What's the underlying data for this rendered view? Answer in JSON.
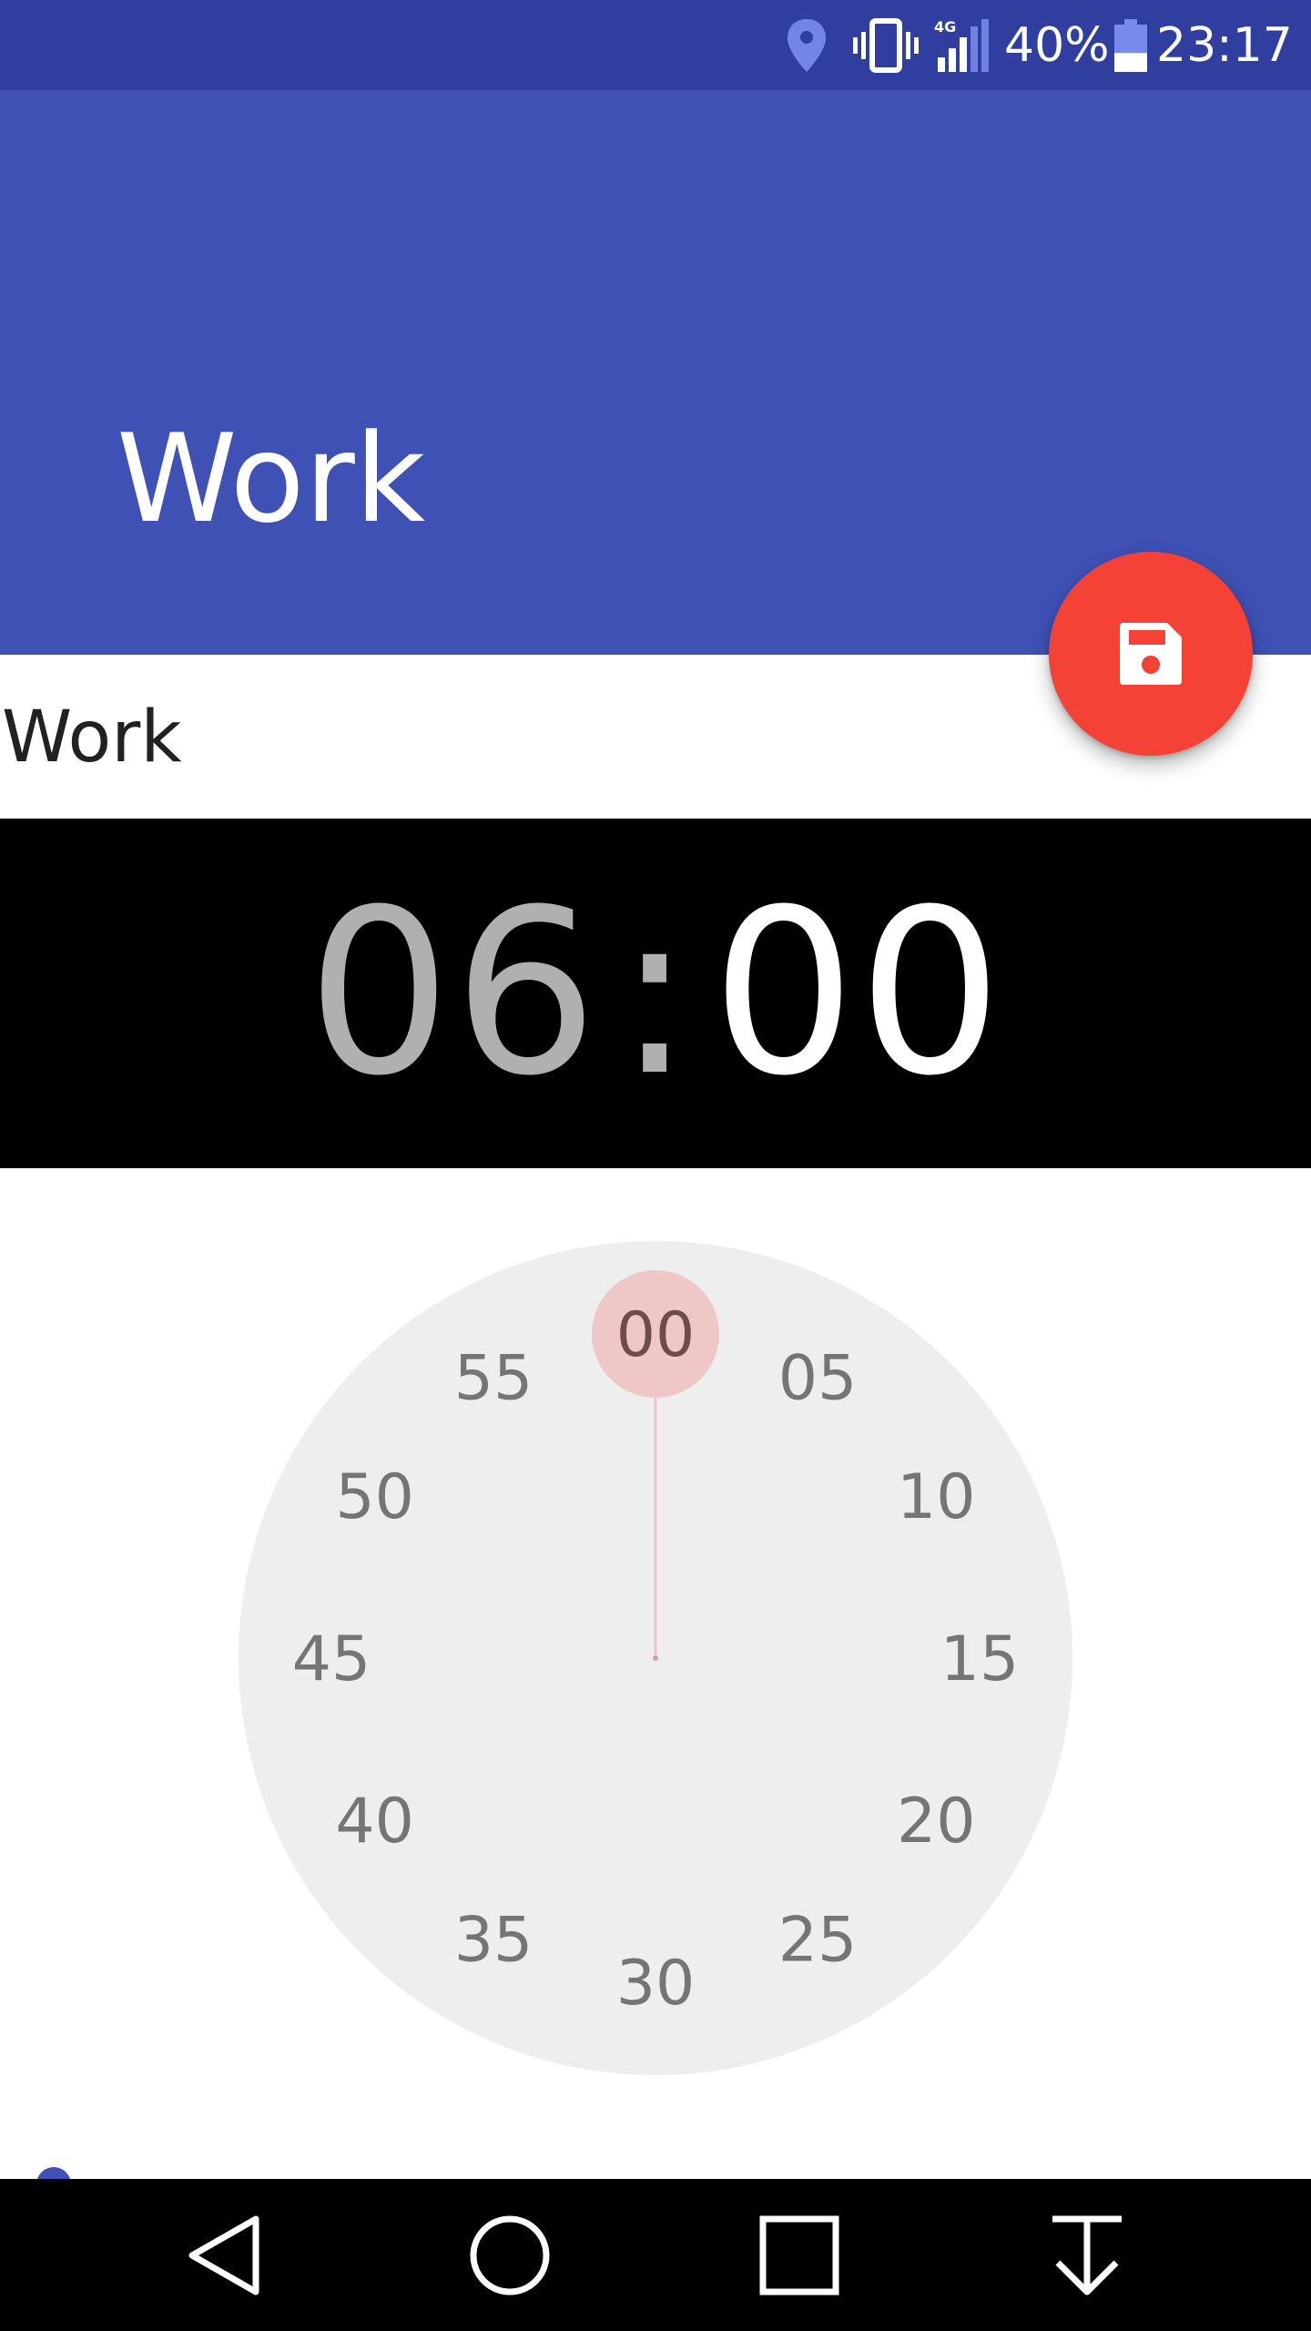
{
  "status_bar": {
    "battery_percent": "40%",
    "battery_level": 0.4,
    "time": "23:17",
    "network_type": "4G",
    "icons": [
      "location-icon",
      "vibrate-icon",
      "signal-4g-icon",
      "battery-icon"
    ]
  },
  "app_bar": {
    "title": "Work"
  },
  "fab": {
    "icon": "save-icon",
    "color": "#F44336"
  },
  "name_field": {
    "value": "Work"
  },
  "time_picker": {
    "hours": "06",
    "separator": ":",
    "minutes": "00",
    "dial_labels": [
      "00",
      "05",
      "10",
      "15",
      "20",
      "25",
      "30",
      "35",
      "40",
      "45",
      "50",
      "55"
    ],
    "selected_label": "00",
    "selected_color": "#EFC7C7"
  },
  "nav_bar": {
    "icons": [
      "back-icon",
      "home-icon",
      "recents-icon",
      "download-icon"
    ]
  },
  "colors": {
    "primary": "#3F51B5",
    "primary_dark": "#303F9F",
    "accent": "#F44336"
  }
}
